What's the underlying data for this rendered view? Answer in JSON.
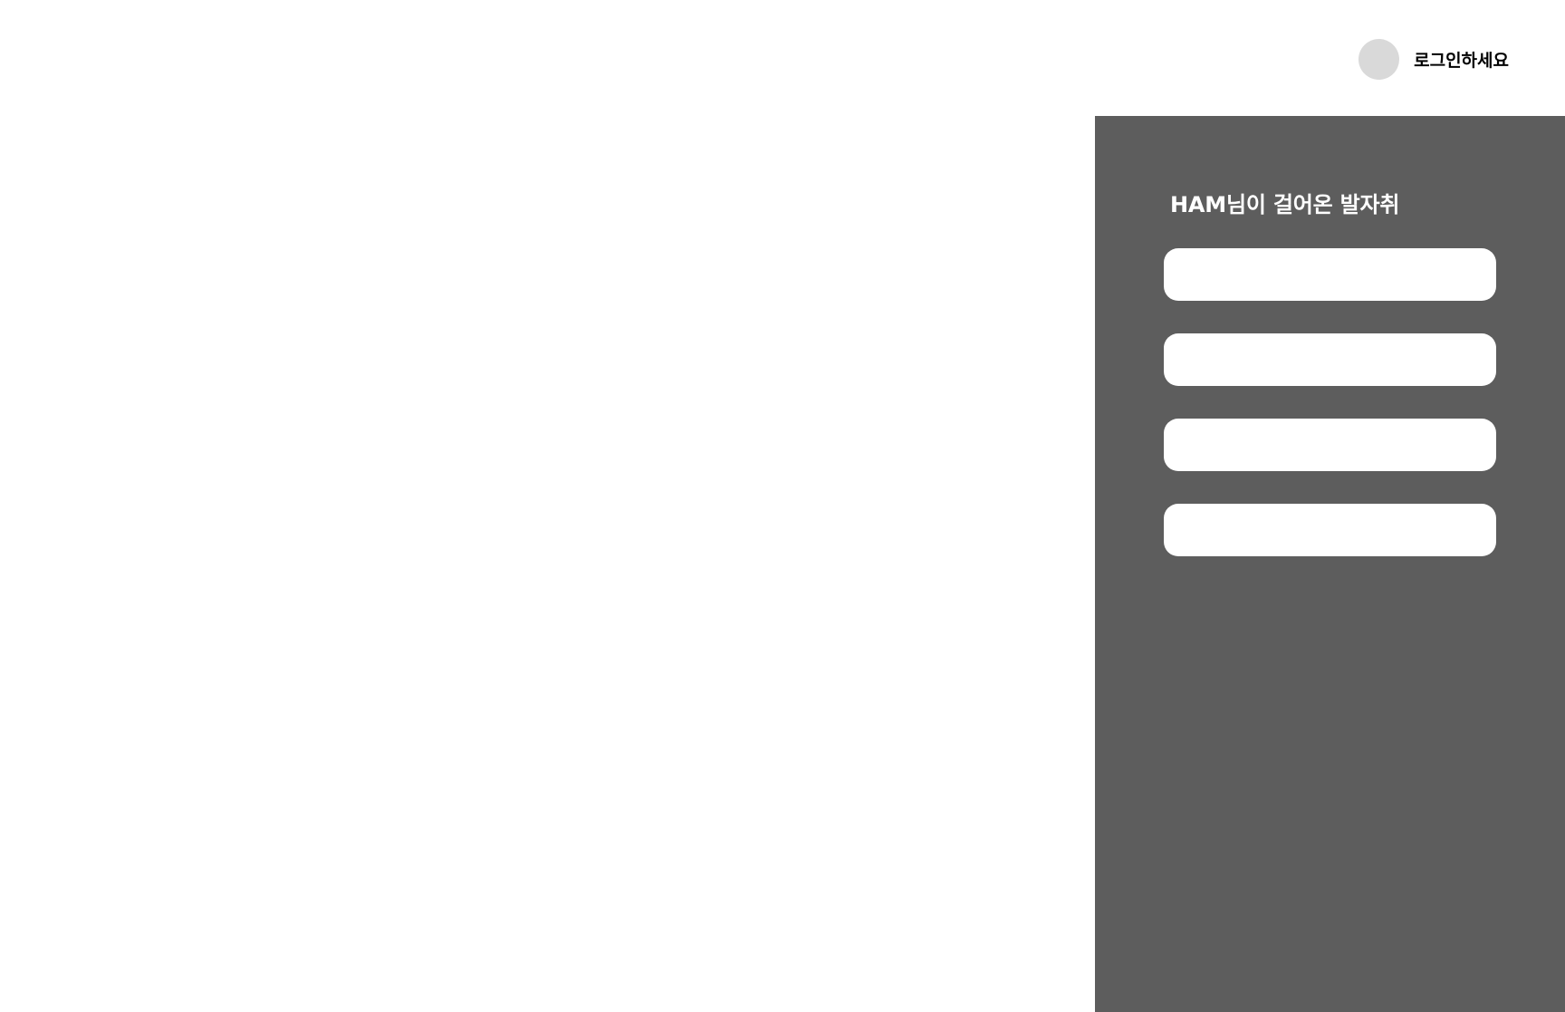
{
  "header": {
    "login_label": "로그인하세요",
    "avatar_color": "#d9d9d9"
  },
  "side_panel": {
    "background_color": "#5d5d5d",
    "title": "HAM님이 걸어온 발자취",
    "items": [
      {
        "label": ""
      },
      {
        "label": ""
      },
      {
        "label": ""
      },
      {
        "label": ""
      }
    ]
  }
}
